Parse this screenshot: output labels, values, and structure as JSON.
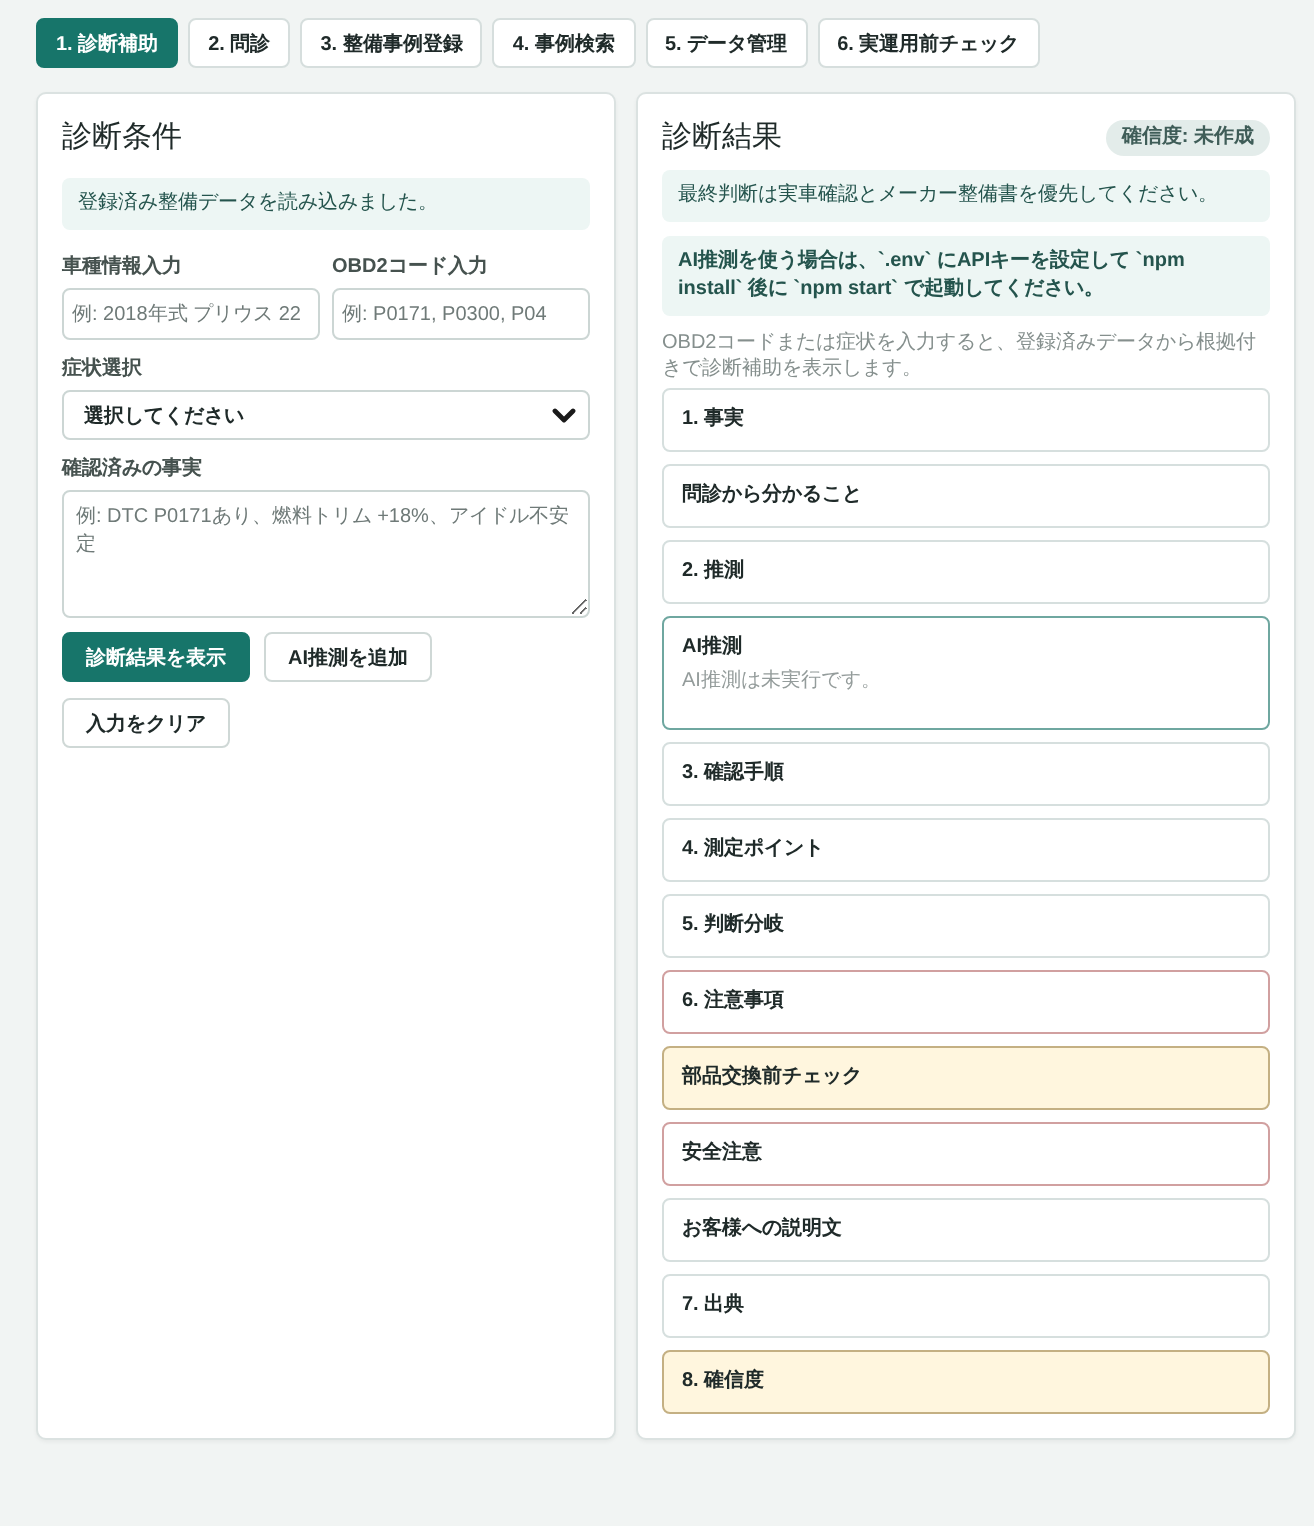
{
  "tabs": [
    {
      "label": "1. 診断補助",
      "selected": true
    },
    {
      "label": "2. 問診",
      "selected": false
    },
    {
      "label": "3. 整備事例登録",
      "selected": false
    },
    {
      "label": "4. 事例検索",
      "selected": false
    },
    {
      "label": "5. データ管理",
      "selected": false
    },
    {
      "label": "6. 実運用前チェック",
      "selected": false
    }
  ],
  "conditions_panel": {
    "title": "診断条件",
    "notice": "登録済み整備データを読み込みました。",
    "fields": [
      {
        "kind": "input",
        "label": "車種情報入力",
        "placeholder": "例: 2018年式 プリウス 22"
      },
      {
        "kind": "input",
        "label": "OBD2コード入力",
        "placeholder": "例: P0171, P0300, P04"
      },
      {
        "kind": "select",
        "label": "症状選択",
        "value": "選択してください"
      },
      {
        "kind": "textarea",
        "label": "確認済みの事実",
        "placeholder": "例: DTC P0171あり、燃料トリム +18%、アイドル不安定"
      }
    ],
    "buttons": [
      {
        "label": "診断結果を表示",
        "kind": "primary"
      },
      {
        "label": "AI推測を追加",
        "kind": "secondary"
      },
      {
        "label": "入力をクリア",
        "kind": "secondary"
      }
    ]
  },
  "results_panel": {
    "title": "診断結果",
    "badge": "確信度: 未作成",
    "notices": [
      {
        "kind": "plain",
        "text": "最終判断は実車確認とメーカー整備書を優先してください。"
      },
      {
        "kind": "strong",
        "text": "AI推測を使う場合は、`.env` にAPIキーを設定して `npm install` 後に `npm start` で起動してください。"
      }
    ],
    "hint": "OBD2コードまたは症状を入力すると、登録済みデータから根拠付きで診断補助を表示します。",
    "sections": [
      {
        "kind": "plain",
        "title": "1. 事実"
      },
      {
        "kind": "plain",
        "title": "問診から分かること"
      },
      {
        "kind": "plain",
        "title": "2. 推測"
      },
      {
        "kind": "accent",
        "title": "AI推測",
        "body": "AI推測は未実行です。"
      },
      {
        "kind": "plain",
        "title": "3. 確認手順"
      },
      {
        "kind": "plain",
        "title": "4. 測定ポイント"
      },
      {
        "kind": "plain",
        "title": "5. 判断分岐"
      },
      {
        "kind": "danger",
        "title": "6. 注意事項"
      },
      {
        "kind": "caution",
        "title": "部品交換前チェック"
      },
      {
        "kind": "danger",
        "title": "安全注意"
      },
      {
        "kind": "plain",
        "title": "お客様への説明文"
      },
      {
        "kind": "plain",
        "title": "7. 出典"
      },
      {
        "kind": "caution",
        "title": "8. 確信度"
      }
    ]
  }
}
